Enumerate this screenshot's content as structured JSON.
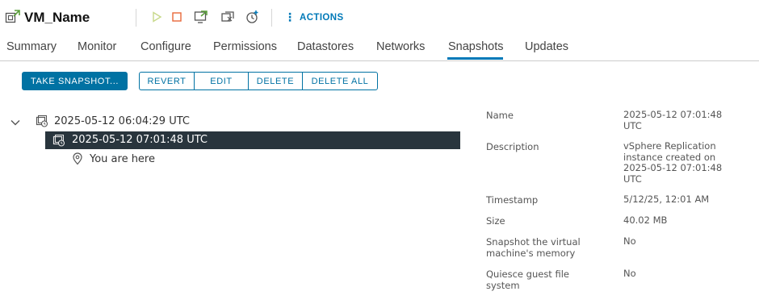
{
  "vm": {
    "name": "VM_Name"
  },
  "toolbar": {
    "actions_label": "ACTIONS"
  },
  "tabs": [
    {
      "label": "Summary"
    },
    {
      "label": "Monitor"
    },
    {
      "label": "Configure"
    },
    {
      "label": "Permissions"
    },
    {
      "label": "Datastores"
    },
    {
      "label": "Networks"
    },
    {
      "label": "Snapshots",
      "active": true
    },
    {
      "label": "Updates"
    }
  ],
  "buttons": {
    "take_snapshot": "TAKE SNAPSHOT...",
    "revert": "REVERT",
    "edit": "EDIT",
    "delete": "DELETE",
    "delete_all": "DELETE ALL"
  },
  "tree": {
    "root": {
      "label": "2025-05-12 06:04:29 UTC"
    },
    "child": {
      "label": "2025-05-12 07:01:48 UTC",
      "selected": true
    },
    "here": {
      "label": "You are here"
    }
  },
  "details": [
    {
      "label": "Name",
      "value": "2025-05-12 07:01:48 UTC"
    },
    {
      "label": "Description",
      "value": "vSphere Replication instance created on 2025-05-12 07:01:48 UTC"
    },
    {
      "label": "Timestamp",
      "value": "5/12/25, 12:01 AM"
    },
    {
      "label": "Size",
      "value": "40.02 MB"
    },
    {
      "label": "Snapshot the virtual machine's memory",
      "value": "No"
    },
    {
      "label": "Quiesce guest file system",
      "value": "No"
    }
  ],
  "colors": {
    "accent": "#0079b8",
    "selected_row": "#29353d",
    "power_on": "#c8d98a",
    "power_off": "#e8683a",
    "console": "#5a9e3a"
  }
}
